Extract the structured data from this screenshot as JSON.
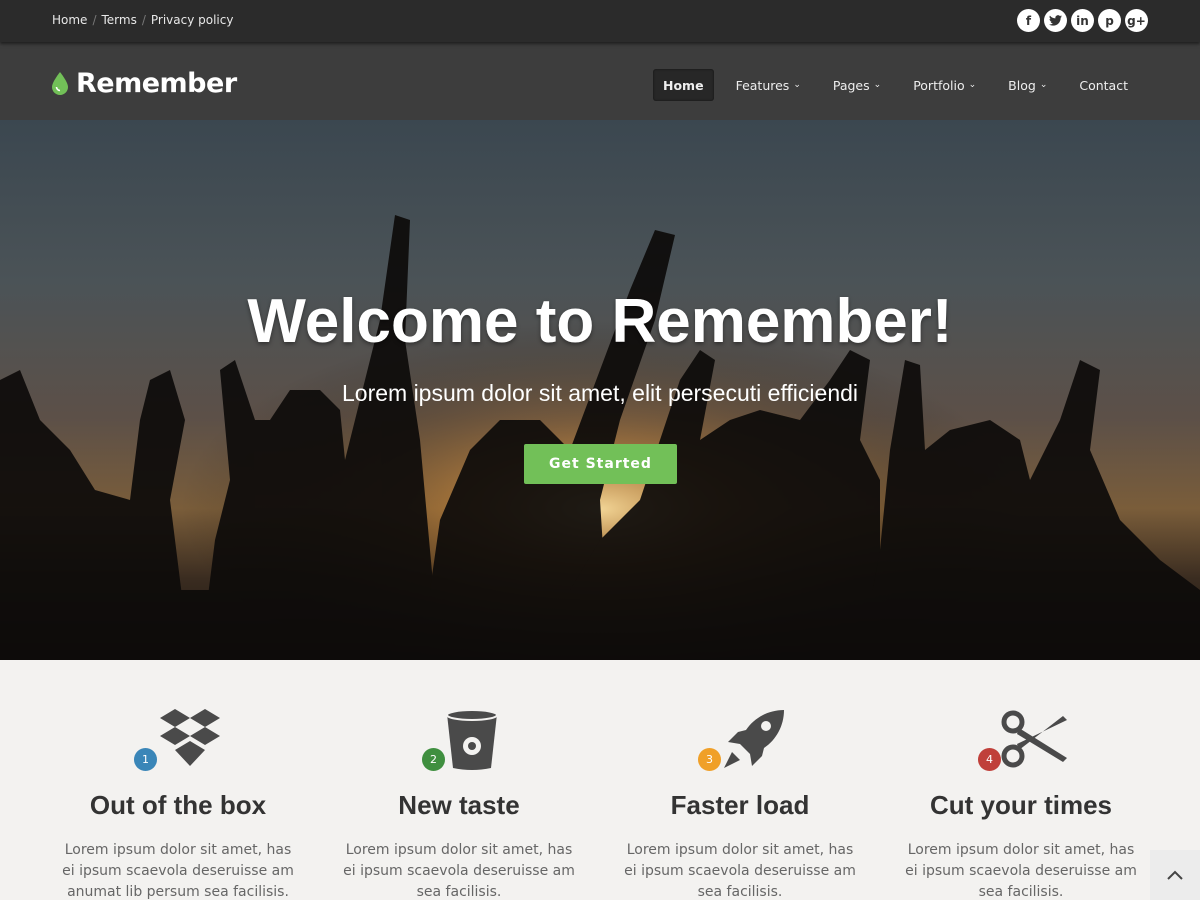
{
  "topbar": {
    "links": [
      {
        "label": "Home"
      },
      {
        "label": "Terms"
      },
      {
        "label": "Privacy policy"
      }
    ],
    "social": [
      {
        "icon": "facebook-icon",
        "glyph": "f"
      },
      {
        "icon": "twitter-icon",
        "glyph": "t"
      },
      {
        "icon": "linkedin-icon",
        "glyph": "in"
      },
      {
        "icon": "pinterest-icon",
        "glyph": "p"
      },
      {
        "icon": "google-plus-icon",
        "glyph": "g+"
      }
    ]
  },
  "brand": {
    "name": "Remember",
    "accent": "#72c058"
  },
  "nav": {
    "items": [
      {
        "label": "Home",
        "active": true,
        "dropdown": false
      },
      {
        "label": "Features",
        "dropdown": true
      },
      {
        "label": "Pages",
        "dropdown": true
      },
      {
        "label": "Portfolio",
        "dropdown": true
      },
      {
        "label": "Blog",
        "dropdown": true
      },
      {
        "label": "Contact",
        "dropdown": false
      }
    ]
  },
  "hero": {
    "title": "Welcome to Remember!",
    "subtitle": "Lorem ipsum dolor sit amet, elit persecuti efficiendi",
    "cta_label": "Get Started",
    "cta_color": "#72c058"
  },
  "features": [
    {
      "num": "1",
      "num_color": "#3a86b8",
      "icon": "dropbox-icon",
      "title": "Out of the box",
      "desc": "Lorem ipsum dolor sit amet, has ei ipsum scaevola deseruisse am anumat lib persum sea facilisis."
    },
    {
      "num": "2",
      "num_color": "#3f8f3f",
      "icon": "bucket-icon",
      "title": "New taste",
      "desc": "Lorem ipsum dolor sit amet, has ei ipsum scaevola deseruisse am sea facilisis."
    },
    {
      "num": "3",
      "num_color": "#f0a028",
      "icon": "rocket-icon",
      "title": "Faster load",
      "desc": "Lorem ipsum dolor sit amet, has ei ipsum scaevola deseruisse am sea facilisis."
    },
    {
      "num": "4",
      "num_color": "#c0403a",
      "icon": "scissors-icon",
      "title": "Cut your times",
      "desc": "Lorem ipsum dolor sit amet, has ei ipsum scaevola deseruisse am sea facilisis."
    }
  ],
  "back_to_top": {
    "icon": "chevron-up-icon"
  }
}
